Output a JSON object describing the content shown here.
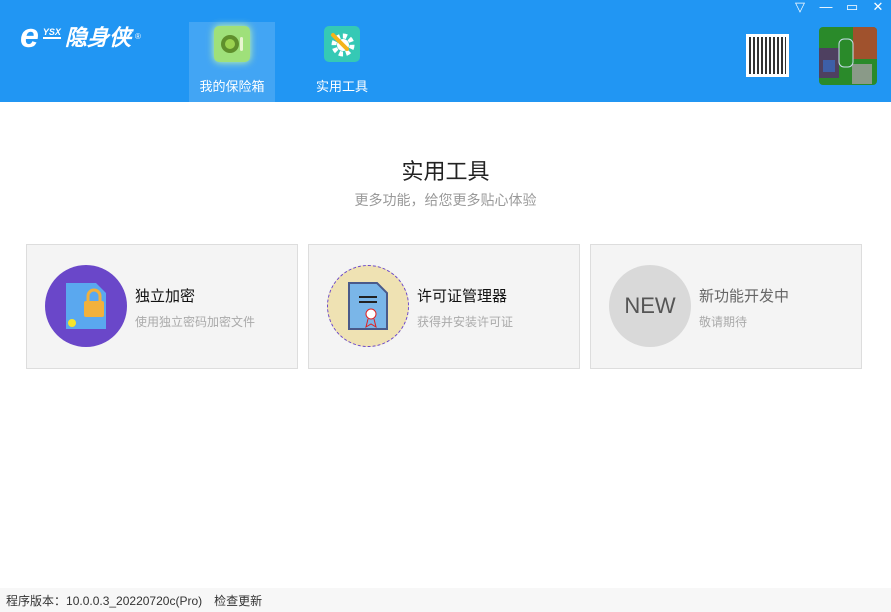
{
  "header": {
    "logo_mark": "e",
    "logo_ysx": "YSX",
    "logo_name": "隐身侠",
    "logo_reg": "®",
    "tabs": [
      {
        "label": "我的保险箱"
      },
      {
        "label": "实用工具"
      }
    ],
    "window": {
      "menu": "▽",
      "minimize": "—",
      "maximize": "▭",
      "close": "✕"
    }
  },
  "main": {
    "title": "实用工具",
    "subtitle": "更多功能，给您更多贴心体验",
    "cards": [
      {
        "title": "独立加密",
        "desc": "使用独立密码加密文件",
        "icon": "lock-file-icon"
      },
      {
        "title": "许可证管理器",
        "desc": "获得并安装许可证",
        "icon": "certificate-icon"
      },
      {
        "title": "新功能开发中",
        "desc": "敬请期待",
        "badge": "NEW"
      }
    ]
  },
  "footer": {
    "version_label": "程序版本：",
    "version": "10.0.0.3_20220720c(Pro)",
    "check_update": "检查更新"
  },
  "colors": {
    "header": "#2196f3",
    "encrypt_circle": "#6a47c9",
    "license_circle": "#efe2b3"
  }
}
